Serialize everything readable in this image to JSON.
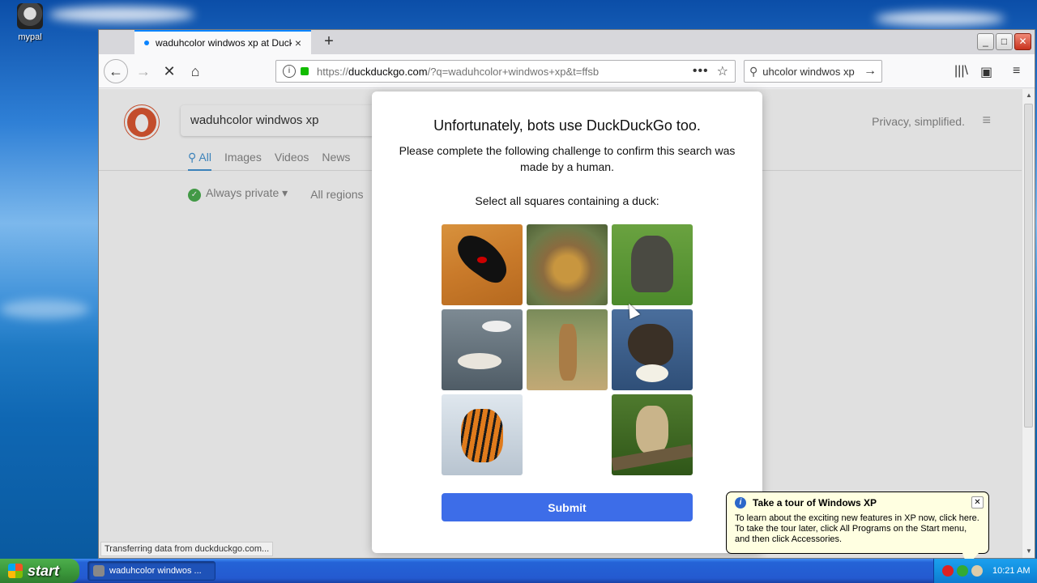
{
  "desktop": {
    "icon_label": "mypal"
  },
  "browser": {
    "tab_title": "waduhcolor windwos xp at DuckDuckGo",
    "tab_close": "×",
    "new_tab": "+",
    "url": {
      "info": "i",
      "host_prefix": "https://",
      "host": "duckduckgo.com",
      "rest": "/?q=waduhcolor+windwos+xp&t=ffsb",
      "more": "•••",
      "star": "☆"
    },
    "search_box": "uhcolor windwos xp",
    "status": "Transferring data from duckduckgo.com..."
  },
  "ddg": {
    "query": "waduhcolor windwos xp",
    "tabs": [
      "All",
      "Images",
      "Videos",
      "News"
    ],
    "privacy_text": "Privacy, simplified.",
    "filters": {
      "always_private": "Always private",
      "all_regions": "All regions"
    }
  },
  "challenge": {
    "title": "Unfortunately, bots use DuckDuckGo too.",
    "subtitle": "Please complete the following challenge to confirm this search was made by a human.",
    "prompt": "Select all squares containing a duck:",
    "cells": [
      "condor",
      "jaguar",
      "elephant",
      "ducks",
      "giraffe",
      "duck",
      "tiger",
      "",
      "lynx"
    ],
    "submit": "Submit"
  },
  "balloon": {
    "title": "Take a tour of Windows XP",
    "body": "To learn about the exciting new features in XP now, click here. To take the tour later, click All Programs on the Start menu, and then click Accessories."
  },
  "taskbar": {
    "start": "start",
    "task": "waduhcolor windwos ...",
    "clock": "10:21 AM"
  }
}
